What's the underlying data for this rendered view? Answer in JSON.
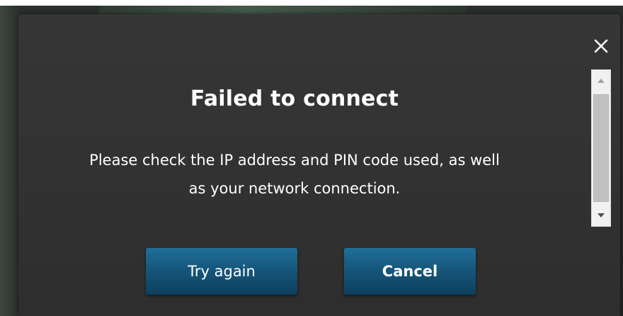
{
  "dialog": {
    "title": "Failed to connect",
    "message_line1": "Please check the IP address and PIN code used, as well",
    "message_line2": "as your network connection.",
    "close_icon": "close-x-icon",
    "buttons": {
      "try_again": "Try again",
      "cancel": "Cancel"
    }
  },
  "colors": {
    "dialog_background": "#333333",
    "button_blue": "#16577c",
    "text": "#ffffff"
  }
}
